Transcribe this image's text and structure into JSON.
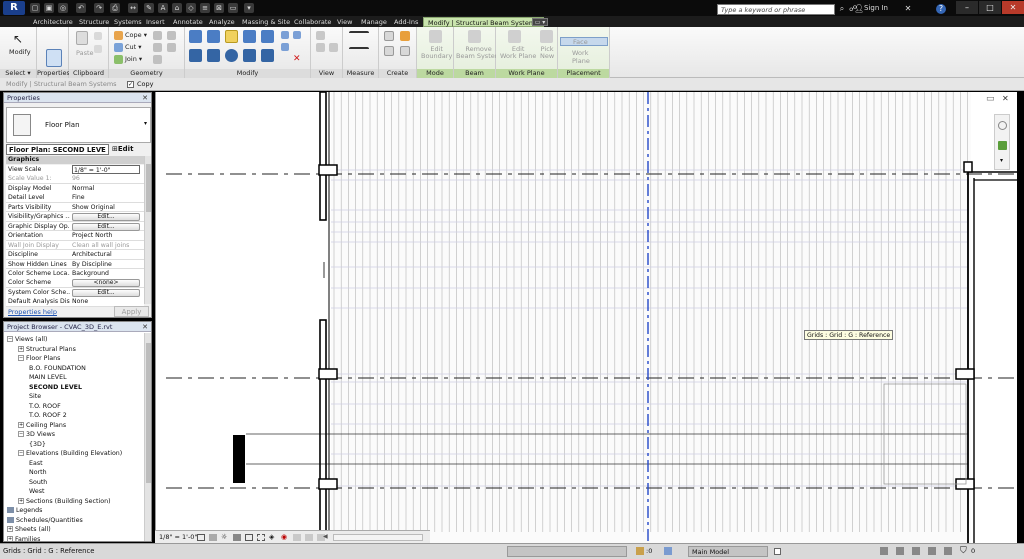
{
  "titlebar": {
    "app_logo": "R",
    "search_placeholder": "Type a keyword or phrase",
    "sign_in": "Sign In",
    "help": "?"
  },
  "tabs": [
    "Architecture",
    "Structure",
    "Systems",
    "Insert",
    "Annotate",
    "Analyze",
    "Massing & Site",
    "Collaborate",
    "View",
    "Manage",
    "Add-Ins",
    "Modify | Structural Beam Systems"
  ],
  "ribbon": {
    "modify_label": "Modify",
    "select_label": "Select ▾",
    "properties_label": "Properties",
    "clipboard_label": "Clipboard",
    "paste_label": "Paste",
    "geometry_label": "Geometry",
    "cope_label": "Cope ▾",
    "cut_label": "Cut ▾",
    "join_label": "Join ▾",
    "modify_panel_label": "Modify",
    "view_label": "View",
    "measure_label": "Measure",
    "create_label": "Create",
    "mode_label": "Mode",
    "edit_boundary_label": "Edit\nBoundary",
    "beam_system_label": "Beam System",
    "remove_beam_system_label": "Remove\nBeam System",
    "work_plane_label": "Work Plane",
    "edit_work_plane_label": "Edit\nWork Plane",
    "pick_new_label": "Pick\nNew",
    "placement_label": "Placement",
    "face_label": "Face",
    "work_plane_opt_label": "Work Plane"
  },
  "optbar": {
    "context": "Modify | Structural Beam Systems",
    "copy_label": "Copy"
  },
  "properties": {
    "title": "Properties",
    "type_name": "Floor Plan",
    "view_selector": "Floor Plan: SECOND LEVE",
    "edit_type": "Edit Type",
    "group": "Graphics",
    "rows": [
      {
        "label": "View Scale",
        "value": "1/8\" = 1'-0\""
      },
      {
        "label": "Scale Value    1:",
        "value": "96"
      },
      {
        "label": "Display Model",
        "value": "Normal"
      },
      {
        "label": "Detail Level",
        "value": "Fine"
      },
      {
        "label": "Parts Visibility",
        "value": "Show Original"
      },
      {
        "label": "Visibility/Graphics ...",
        "value": "Edit..."
      },
      {
        "label": "Graphic Display Op...",
        "value": "Edit..."
      },
      {
        "label": "Orientation",
        "value": "Project North"
      },
      {
        "label": "Wall Join Display",
        "value": "Clean all wall joins"
      },
      {
        "label": "Discipline",
        "value": "Architectural"
      },
      {
        "label": "Show Hidden Lines",
        "value": "By Discipline"
      },
      {
        "label": "Color Scheme Loca...",
        "value": "Background"
      },
      {
        "label": "Color Scheme",
        "value": "<none>"
      },
      {
        "label": "System Color Sche...",
        "value": "Edit..."
      },
      {
        "label": "Default Analysis Dis...",
        "value": "None"
      }
    ],
    "help_link": "Properties help",
    "apply": "Apply"
  },
  "browser": {
    "title": "Project Browser - CVAC_3D_E.rvt",
    "items": [
      {
        "label": "Views (all)",
        "level": 0,
        "exp": "−"
      },
      {
        "label": "Structural Plans",
        "level": 1,
        "exp": "+"
      },
      {
        "label": "Floor Plans",
        "level": 1,
        "exp": "−"
      },
      {
        "label": "B.O. FOUNDATION",
        "level": 2,
        "exp": ""
      },
      {
        "label": "MAIN LEVEL",
        "level": 2,
        "exp": ""
      },
      {
        "label": "SECOND LEVEL",
        "level": 2,
        "exp": ""
      },
      {
        "label": "Site",
        "level": 2,
        "exp": ""
      },
      {
        "label": "T.O. ROOF",
        "level": 2,
        "exp": ""
      },
      {
        "label": "T.O. ROOF 2",
        "level": 2,
        "exp": ""
      },
      {
        "label": "Ceiling Plans",
        "level": 1,
        "exp": "+"
      },
      {
        "label": "3D Views",
        "level": 1,
        "exp": "−"
      },
      {
        "label": "{3D}",
        "level": 2,
        "exp": ""
      },
      {
        "label": "Elevations (Building Elevation)",
        "level": 1,
        "exp": "−"
      },
      {
        "label": "East",
        "level": 2,
        "exp": ""
      },
      {
        "label": "North",
        "level": 2,
        "exp": ""
      },
      {
        "label": "South",
        "level": 2,
        "exp": ""
      },
      {
        "label": "West",
        "level": 2,
        "exp": ""
      },
      {
        "label": "Sections (Building Section)",
        "level": 1,
        "exp": "+"
      },
      {
        "label": "Legends",
        "level": 0,
        "exp": ""
      },
      {
        "label": "Schedules/Quantities",
        "level": 0,
        "exp": ""
      },
      {
        "label": "Sheets (all)",
        "level": 0,
        "exp": "+"
      },
      {
        "label": "Families",
        "level": 0,
        "exp": "+"
      }
    ]
  },
  "canvas": {
    "tooltip": "Grids : Grid : G : Reference"
  },
  "viewbar": {
    "scale": "1/8\" = 1'-0\""
  },
  "status": {
    "text": "Grids : Grid : G : Reference",
    "zero": ":0",
    "model": "Main Model",
    "filter_count": "0"
  }
}
